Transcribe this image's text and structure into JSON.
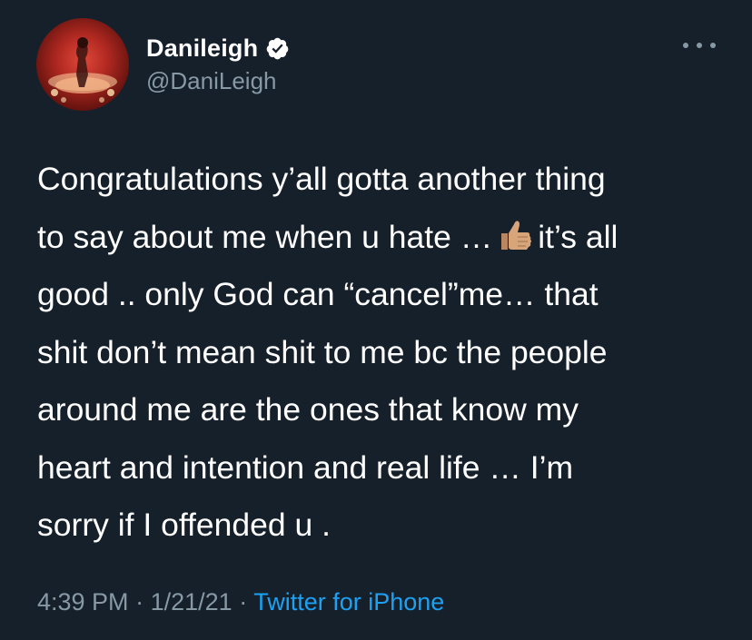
{
  "tweet": {
    "author": {
      "display_name": "Danileigh",
      "handle": "@DaniLeigh",
      "verified": true
    },
    "more_icon": "more-horizontal-icon",
    "text_lines": [
      "Congratulations y’all gotta another thing",
      "to say about me when u hate …",
      "it’s all",
      "good .. only God can “cancel”me… that",
      "shit don’t mean shit to me bc the people",
      "around me are the ones that know my",
      "heart and intention and real life … I’m",
      "sorry if I offended u ."
    ],
    "emoji": "thumbs-up-icon",
    "meta": {
      "time": "4:39 PM",
      "separator": "·",
      "date": "1/21/21",
      "source": "Twitter for iPhone"
    }
  },
  "colors": {
    "background": "#15202b",
    "text": "#ffffff",
    "secondary": "#8899a6",
    "accent": "#1da1f2"
  }
}
